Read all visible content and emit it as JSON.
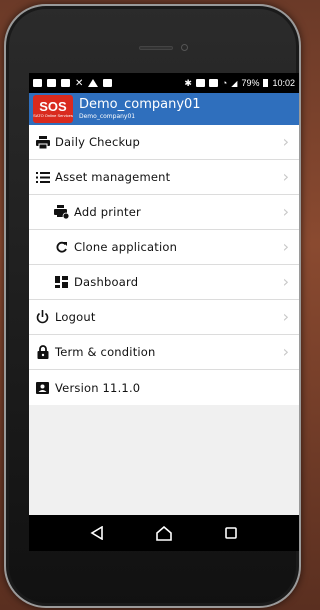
{
  "statusbar": {
    "battery": "79%",
    "time": "10:02"
  },
  "header": {
    "logo_text": "SOS",
    "logo_subtext": "SATO Online Services",
    "title": "Demo_company01",
    "subtitle": "Demo_company01"
  },
  "menu": {
    "items": [
      {
        "label": "Daily Checkup",
        "icon": "printer-icon"
      },
      {
        "label": "Asset management",
        "icon": "list-icon"
      },
      {
        "label": "Add printer",
        "icon": "add-printer-icon"
      },
      {
        "label": "Clone application",
        "icon": "refresh-icon"
      },
      {
        "label": "Dashboard",
        "icon": "dashboard-icon"
      },
      {
        "label": "Logout",
        "icon": "power-icon"
      },
      {
        "label": "Term & condition",
        "icon": "lock-icon"
      },
      {
        "label": "Version 11.1.0",
        "icon": "id-card-icon"
      }
    ]
  },
  "navbar": {
    "buttons": [
      "back-icon",
      "home-icon",
      "recents-icon"
    ]
  }
}
